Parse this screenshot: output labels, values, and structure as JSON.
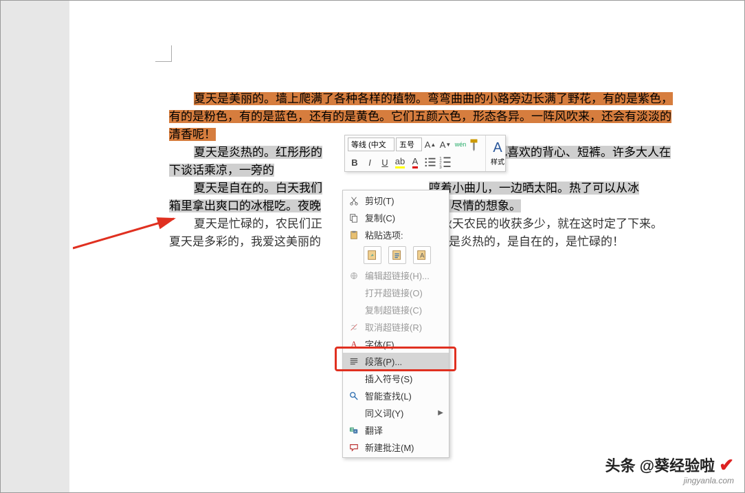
{
  "document": {
    "p1": "夏天是美丽的。墙上爬满了各种各样的植物。弯弯曲曲的小路旁边长满了野花，有的是紫色，有的是粉色，有的是蓝色，还有的是黄色。它们五颜六色，形态各异。一阵风吹来，还会有淡淡的清香呢！",
    "p2a": "夏天是炎热的。红彤彤的",
    "p2b": "自己喜欢的背心、短裤。许多大人在下谈话乘凉，一旁的",
    "p3a": "夏天是自在的。白天我们",
    "p3b": "哼着小曲儿，一边晒太阳。热了可以从冰箱里拿出爽口的冰棍吃。夜晚",
    "p3c": "空，尽情的想象。",
    "p4a": "夏天是忙碌的，农民们正",
    "p4b": "为秋天农民的收获多少，就在这时定了下来。",
    "p5a": "夏天是多彩的，我爱这美丽的",
    "p5b": "丽的，是炎热的，是自在的，是忙碌的！"
  },
  "miniToolbar": {
    "font": "等线 (中文",
    "size": "五号",
    "stylesLabel": "样式"
  },
  "contextMenu": {
    "cut": "剪切(T)",
    "copy": "复制(C)",
    "pasteTitle": "粘贴选项:",
    "editLink": "编辑超链接(H)...",
    "openLink": "打开超链接(O)",
    "copyLink": "复制超链接(C)",
    "removeLink": "取消超链接(R)",
    "font": "字体(F)...",
    "paragraph": "段落(P)...",
    "insertSymbol": "插入符号(S)",
    "smartLookup": "智能查找(L)",
    "synonyms": "同义词(Y)",
    "translate": "翻译",
    "newComment": "新建批注(M)"
  },
  "watermark": {
    "text": "头条 @葵经验啦",
    "url": "jingyanla.com"
  }
}
